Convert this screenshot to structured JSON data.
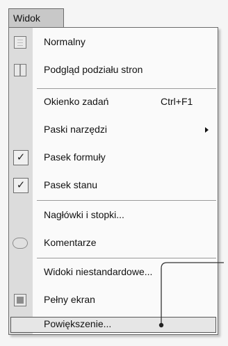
{
  "menubar": {
    "view_label": "Widok"
  },
  "menu": {
    "items": [
      {
        "label": "Normalny",
        "icon": "normal-view-icon"
      },
      {
        "label": "Podgląd podziału stron",
        "icon": "page-break-preview-icon"
      },
      {
        "label": "Okienko zadań",
        "shortcut": "Ctrl+F1"
      },
      {
        "label": "Paski narzędzi",
        "icon": "chevron-right-icon"
      },
      {
        "label": "Pasek formuły",
        "checked": true
      },
      {
        "label": "Pasek stanu",
        "checked": true
      },
      {
        "label": "Nagłówki i stopki..."
      },
      {
        "label": "Komentarze",
        "icon": "comments-icon"
      },
      {
        "label": "Widoki niestandardowe..."
      },
      {
        "label": "Pełny ekran",
        "icon": "full-screen-icon"
      },
      {
        "label": "Powiększenie..."
      }
    ]
  },
  "check_glyph": "✓"
}
